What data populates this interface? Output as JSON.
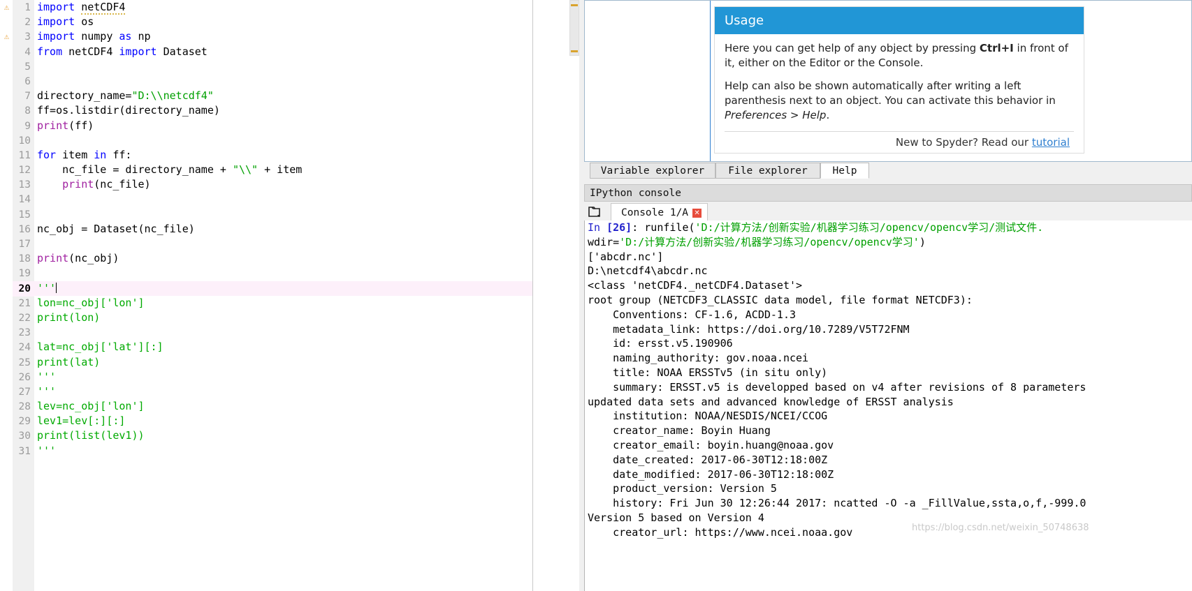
{
  "editor": {
    "warnings_at_lines": [
      1,
      3
    ],
    "current_line": 20,
    "lines": [
      {
        "n": "1",
        "tokens": [
          {
            "t": "import ",
            "c": "kw"
          },
          {
            "t": "netCDF4",
            "c": "plain squig"
          }
        ]
      },
      {
        "n": "2",
        "tokens": [
          {
            "t": "import ",
            "c": "kw"
          },
          {
            "t": "os",
            "c": "plain"
          }
        ]
      },
      {
        "n": "3",
        "tokens": [
          {
            "t": "import ",
            "c": "kw"
          },
          {
            "t": "numpy ",
            "c": "plain"
          },
          {
            "t": "as ",
            "c": "kw"
          },
          {
            "t": "np",
            "c": "plain"
          }
        ]
      },
      {
        "n": "4",
        "tokens": [
          {
            "t": "from ",
            "c": "kw"
          },
          {
            "t": "netCDF4 ",
            "c": "plain"
          },
          {
            "t": "import ",
            "c": "kw"
          },
          {
            "t": "Dataset",
            "c": "plain"
          }
        ]
      },
      {
        "n": "5",
        "tokens": []
      },
      {
        "n": "6",
        "tokens": []
      },
      {
        "n": "7",
        "tokens": [
          {
            "t": "directory_name=",
            "c": "plain"
          },
          {
            "t": "\"D:\\\\netcdf4\"",
            "c": "str"
          }
        ]
      },
      {
        "n": "8",
        "tokens": [
          {
            "t": "ff=os.listdir(directory_name)",
            "c": "plain"
          }
        ]
      },
      {
        "n": "9",
        "tokens": [
          {
            "t": "print",
            "c": "bi"
          },
          {
            "t": "(ff)",
            "c": "plain"
          }
        ]
      },
      {
        "n": "10",
        "tokens": []
      },
      {
        "n": "11",
        "tokens": [
          {
            "t": "for ",
            "c": "kw"
          },
          {
            "t": "item ",
            "c": "plain"
          },
          {
            "t": "in ",
            "c": "kw"
          },
          {
            "t": "ff:",
            "c": "plain"
          }
        ]
      },
      {
        "n": "12",
        "tokens": [
          {
            "t": "    nc_file = directory_name + ",
            "c": "plain"
          },
          {
            "t": "\"\\\\\"",
            "c": "str"
          },
          {
            "t": " + item",
            "c": "plain"
          }
        ]
      },
      {
        "n": "13",
        "tokens": [
          {
            "t": "    ",
            "c": "plain"
          },
          {
            "t": "print",
            "c": "bi"
          },
          {
            "t": "(nc_file)",
            "c": "plain"
          }
        ]
      },
      {
        "n": "14",
        "tokens": []
      },
      {
        "n": "15",
        "tokens": []
      },
      {
        "n": "16",
        "tokens": [
          {
            "t": "nc_obj = Dataset(nc_file)",
            "c": "plain"
          }
        ]
      },
      {
        "n": "17",
        "tokens": []
      },
      {
        "n": "18",
        "tokens": [
          {
            "t": "print",
            "c": "bi"
          },
          {
            "t": "(nc_obj)",
            "c": "plain"
          }
        ]
      },
      {
        "n": "19",
        "tokens": []
      },
      {
        "n": "20",
        "tokens": [
          {
            "t": "'''",
            "c": "grn"
          }
        ],
        "caret": true
      },
      {
        "n": "21",
        "tokens": [
          {
            "t": "lon=nc_obj['lon']",
            "c": "grn"
          }
        ]
      },
      {
        "n": "22",
        "tokens": [
          {
            "t": "print(lon)",
            "c": "grn"
          }
        ]
      },
      {
        "n": "23",
        "tokens": []
      },
      {
        "n": "24",
        "tokens": [
          {
            "t": "lat=nc_obj['lat'][:]",
            "c": "grn"
          }
        ]
      },
      {
        "n": "25",
        "tokens": [
          {
            "t": "print(lat)",
            "c": "grn"
          }
        ]
      },
      {
        "n": "26",
        "tokens": [
          {
            "t": "'''",
            "c": "grn"
          }
        ]
      },
      {
        "n": "27",
        "tokens": [
          {
            "t": "'''",
            "c": "grn"
          }
        ]
      },
      {
        "n": "28",
        "tokens": [
          {
            "t": "lev=nc_obj['lon']",
            "c": "grn"
          }
        ]
      },
      {
        "n": "29",
        "tokens": [
          {
            "t": "lev1=lev[:][:]",
            "c": "grn"
          }
        ]
      },
      {
        "n": "30",
        "tokens": [
          {
            "t": "print(list(lev1))",
            "c": "grn"
          }
        ]
      },
      {
        "n": "31",
        "tokens": [
          {
            "t": "'''",
            "c": "grn"
          }
        ]
      }
    ]
  },
  "help": {
    "card_title": "Usage",
    "paragraph1_pre": "Here you can get help of any object by pressing ",
    "paragraph1_kbd": "Ctrl+I",
    "paragraph1_post": " in front of it, either on the Editor or the Console.",
    "paragraph2_pre": "Help can also be shown automatically after writing a left parenthesis next to an object. You can activate this behavior in ",
    "paragraph2_em": "Preferences > Help",
    "paragraph2_post": ".",
    "tutorial_prefix": "New to Spyder? Read our ",
    "tutorial_link": "tutorial"
  },
  "dock_tabs": [
    {
      "label": "Variable explorer",
      "active": false
    },
    {
      "label": "File explorer",
      "active": false
    },
    {
      "label": "Help",
      "active": true
    }
  ],
  "console": {
    "panel_title": "IPython console",
    "tab_label": "Console 1/A",
    "close_glyph": "✕",
    "lines": [
      {
        "parts": [
          {
            "t": "In ",
            "c": "in-prompt"
          },
          {
            "t": "[26]",
            "c": "in-num"
          },
          {
            "t": ": runfile(",
            "c": "plain"
          },
          {
            "t": "'D:/计算方法/创新实验/机器学习练习/opencv/opencv学习/测试文件.",
            "c": "ostr"
          }
        ]
      },
      {
        "parts": [
          {
            "t": "wdir=",
            "c": "plain"
          },
          {
            "t": "'D:/计算方法/创新实验/机器学习练习/opencv/opencv学习'",
            "c": "ostr"
          },
          {
            "t": ")",
            "c": "plain"
          }
        ]
      },
      {
        "parts": [
          {
            "t": "['abcdr.nc']",
            "c": "plain"
          }
        ]
      },
      {
        "parts": [
          {
            "t": "D:\\netcdf4\\abcdr.nc",
            "c": "plain"
          }
        ]
      },
      {
        "parts": [
          {
            "t": "<class 'netCDF4._netCDF4.Dataset'>",
            "c": "plain"
          }
        ]
      },
      {
        "parts": [
          {
            "t": "root group (NETCDF3_CLASSIC data model, file format NETCDF3):",
            "c": "plain"
          }
        ]
      },
      {
        "parts": [
          {
            "t": "    Conventions: CF-1.6, ACDD-1.3",
            "c": "plain"
          }
        ]
      },
      {
        "parts": [
          {
            "t": "    metadata_link: https://doi.org/10.7289/V5T72FNM",
            "c": "plain"
          }
        ]
      },
      {
        "parts": [
          {
            "t": "    id: ersst.v5.190906",
            "c": "plain"
          }
        ]
      },
      {
        "parts": [
          {
            "t": "    naming_authority: gov.noaa.ncei",
            "c": "plain"
          }
        ]
      },
      {
        "parts": [
          {
            "t": "    title: NOAA ERSSTv5 (in situ only)",
            "c": "plain"
          }
        ]
      },
      {
        "parts": [
          {
            "t": "    summary: ERSST.v5 is developped based on v4 after revisions of 8 parameters",
            "c": "plain"
          }
        ]
      },
      {
        "parts": [
          {
            "t": "updated data sets and advanced knowledge of ERSST analysis",
            "c": "plain"
          }
        ]
      },
      {
        "parts": [
          {
            "t": "    institution: NOAA/NESDIS/NCEI/CCOG",
            "c": "plain"
          }
        ]
      },
      {
        "parts": [
          {
            "t": "    creator_name: Boyin Huang",
            "c": "plain"
          }
        ]
      },
      {
        "parts": [
          {
            "t": "    creator_email: boyin.huang@noaa.gov",
            "c": "plain"
          }
        ]
      },
      {
        "parts": [
          {
            "t": "    date_created: 2017-06-30T12:18:00Z",
            "c": "plain"
          }
        ]
      },
      {
        "parts": [
          {
            "t": "    date_modified: 2017-06-30T12:18:00Z",
            "c": "plain"
          }
        ]
      },
      {
        "parts": [
          {
            "t": "    product_version: Version 5",
            "c": "plain"
          }
        ]
      },
      {
        "parts": [
          {
            "t": "    history: Fri Jun 30 12:26:44 2017: ncatted -O -a _FillValue,ssta,o,f,-999.0",
            "c": "plain"
          }
        ]
      },
      {
        "parts": [
          {
            "t": "Version 5 based on Version 4",
            "c": "plain"
          }
        ]
      },
      {
        "parts": [
          {
            "t": "    creator_url: https://www.ncei.noaa.gov",
            "c": "plain"
          }
        ]
      }
    ]
  },
  "watermark": "https://blog.csdn.net/weixin_50748638",
  "colors": {
    "accent_blue": "#2196d6",
    "string_green": "#00a000",
    "keyword_blue": "#0000ff",
    "builtin_purple": "#a020a0",
    "current_line_pink": "#fdf0fa",
    "warning_orange": "#e8a33d"
  }
}
